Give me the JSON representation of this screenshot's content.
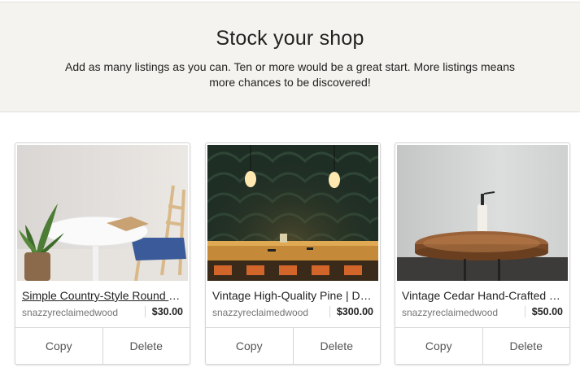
{
  "banner": {
    "title": "Stock your shop",
    "description": "Add as many listings as you can. Ten or more would be a great start. More listings means more chances to be discovered!"
  },
  "listings": [
    {
      "title": "Simple Country-Style Round Table",
      "shop": "snazzyreclaimedwood",
      "price": "$30.00",
      "copy_label": "Copy",
      "delete_label": "Delete",
      "image": "white-round-table-photo"
    },
    {
      "title": "Vintage High-Quality Pine | Dining Table",
      "shop": "snazzyreclaimedwood",
      "price": "$300.00",
      "copy_label": "Copy",
      "delete_label": "Delete",
      "image": "pine-dining-table-photo"
    },
    {
      "title": "Vintage Cedar Hand-Crafted Table",
      "shop": "snazzyreclaimedwood",
      "price": "$50.00",
      "copy_label": "Copy",
      "delete_label": "Delete",
      "image": "cedar-table-photo"
    }
  ]
}
